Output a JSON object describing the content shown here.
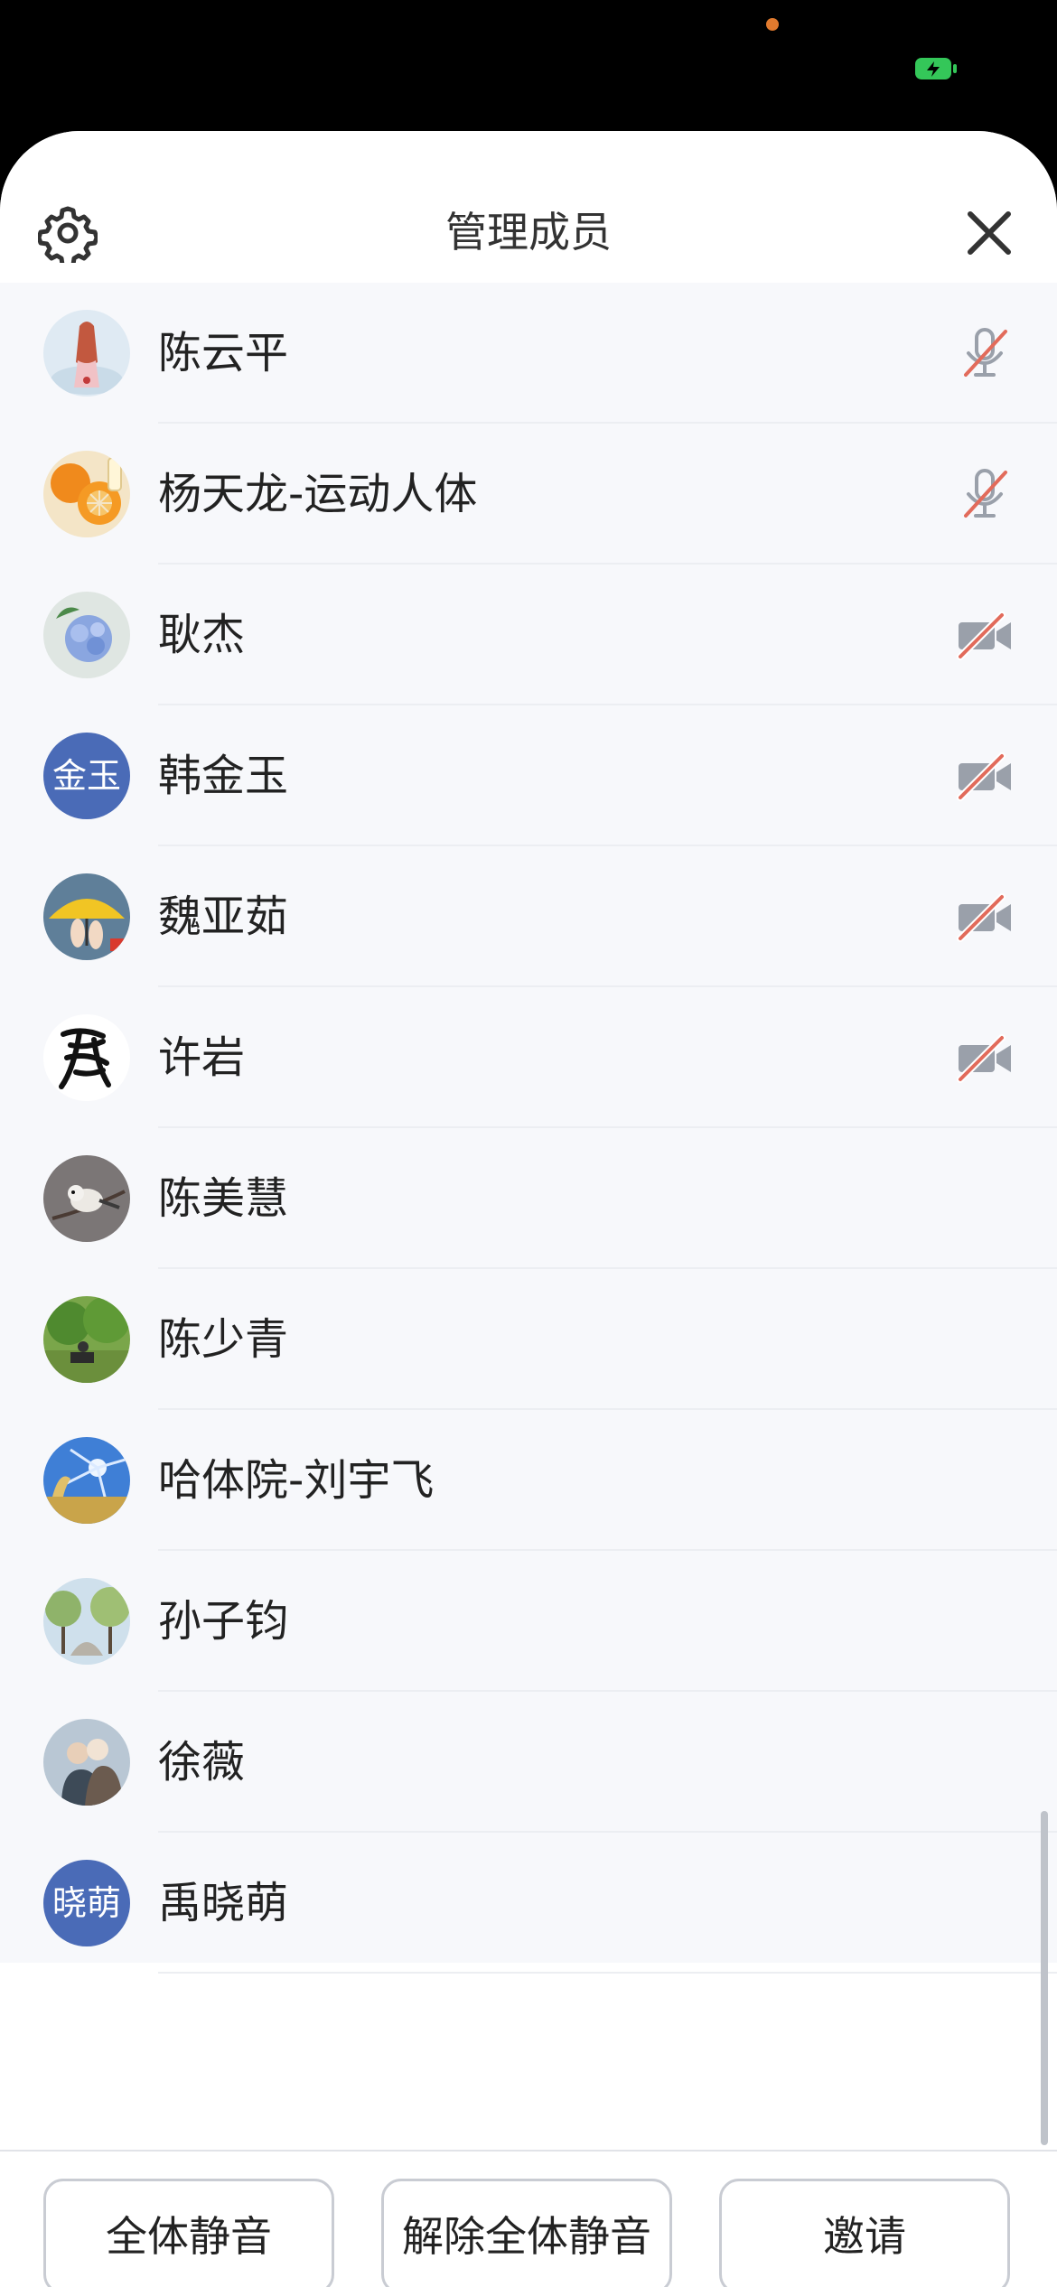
{
  "header": {
    "title": "管理成员"
  },
  "members": [
    {
      "name": "陈云平",
      "avatar_icon": "girl-painting-avatar",
      "status": "mic-muted"
    },
    {
      "name": "杨天龙-运动人体",
      "avatar_icon": "oranges-avatar",
      "status": "mic-muted"
    },
    {
      "name": "耿杰",
      "avatar_icon": "blue-flowers-avatar",
      "status": "video-off"
    },
    {
      "name": "韩金玉",
      "avatar_text": "金玉",
      "status": "video-off"
    },
    {
      "name": "魏亚茹",
      "avatar_icon": "umbrella-avatar",
      "status": "video-off"
    },
    {
      "name": "许岩",
      "avatar_icon": "calligraphy-avatar",
      "status": "video-off"
    },
    {
      "name": "陈美慧",
      "avatar_icon": "bird-avatar",
      "status": ""
    },
    {
      "name": "陈少青",
      "avatar_icon": "park-avatar",
      "status": ""
    },
    {
      "name": "哈体院-刘宇飞",
      "avatar_icon": "sky-avatar",
      "status": ""
    },
    {
      "name": "孙子钧",
      "avatar_icon": "trees-avatar",
      "status": ""
    },
    {
      "name": "徐薇",
      "avatar_icon": "couple-avatar",
      "status": ""
    },
    {
      "name": "禹晓萌",
      "avatar_text": "晓萌",
      "status": ""
    }
  ],
  "footer": {
    "mute_all_label": "全体静音",
    "unmute_all_label": "解除全体静音",
    "invite_label": "邀请"
  },
  "colors": {
    "avatar_text_bg": "#4a6bb7",
    "muted_slash": "#e26b5b",
    "icon_gray": "#9aa0aa",
    "list_bg": "#f7f8fb"
  }
}
